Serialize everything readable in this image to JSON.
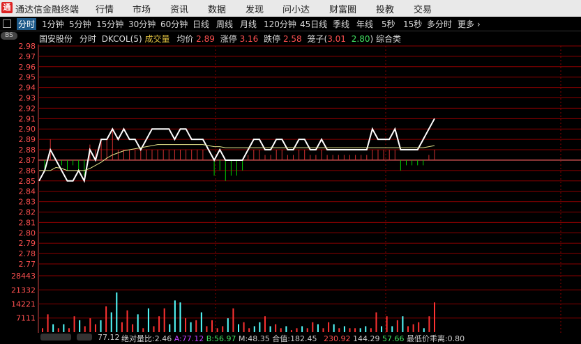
{
  "app": {
    "name": "通达信金融终端",
    "logo": "通"
  },
  "menu": [
    "行情",
    "市场",
    "资讯",
    "数据",
    "发现",
    "问小达",
    "财富圈",
    "投教",
    "交易"
  ],
  "toolbar": {
    "items": [
      "分时",
      "1分钟",
      "5分钟",
      "15分钟",
      "30分钟",
      "60分钟",
      "日线",
      "周线",
      "月线",
      "120分钟",
      "45日线",
      "季线",
      "年线",
      "5秒",
      "15秒",
      "多分时",
      "更多"
    ],
    "active": "分时",
    "more_icon": "chevron-right-icon"
  },
  "badge": "BS",
  "info": {
    "stock_name": "国安股份",
    "mode": "分时",
    "indicator": "DKCOL(5)",
    "vol_label": "成交量",
    "avg_label": "均价",
    "avg_value": "2.89",
    "limit_up_label": "涨停",
    "limit_up_value": "3.16",
    "limit_down_label": "跌停",
    "limit_down_value": "2.58",
    "cage_label": "笼子",
    "cage_open": "(",
    "cage_v1": "3.01",
    "cage_v2": "2.80",
    "cage_close": ")",
    "category": "综合类"
  },
  "chart_data": [
    {
      "type": "line",
      "ylim": [
        2.77,
        2.98
      ],
      "y_ticks": [
        "2.98",
        "2.97",
        "2.96",
        "2.95",
        "2.94",
        "2.93",
        "2.92",
        "2.91",
        "2.90",
        "2.89",
        "2.88",
        "2.87",
        "2.86",
        "2.85",
        "2.84",
        "2.83",
        "2.82",
        "2.81",
        "2.80",
        "2.79",
        "2.78",
        "2.77"
      ],
      "reference_price": 2.87,
      "series": [
        {
          "name": "price",
          "color": "#ffffff",
          "values": [
            2.85,
            2.86,
            2.88,
            2.87,
            2.86,
            2.85,
            2.85,
            2.86,
            2.85,
            2.88,
            2.87,
            2.89,
            2.89,
            2.9,
            2.89,
            2.9,
            2.89,
            2.89,
            2.88,
            2.89,
            2.9,
            2.9,
            2.9,
            2.9,
            2.89,
            2.9,
            2.9,
            2.89,
            2.89,
            2.89,
            2.88,
            2.87,
            2.88,
            2.87,
            2.87,
            2.87,
            2.87,
            2.88,
            2.89,
            2.89,
            2.88,
            2.88,
            2.89,
            2.89,
            2.88,
            2.88,
            2.89,
            2.89,
            2.88,
            2.88,
            2.89,
            2.88,
            2.88,
            2.88,
            2.88,
            2.88,
            2.88,
            2.88,
            2.88,
            2.9,
            2.89,
            2.89,
            2.89,
            2.9,
            2.88,
            2.88,
            2.88,
            2.88,
            2.89,
            2.9,
            2.91
          ]
        },
        {
          "name": "avg",
          "color": "#e6e68c",
          "values": [
            2.86,
            2.86,
            2.86,
            2.863,
            2.862,
            2.86,
            2.86,
            2.86,
            2.86,
            2.862,
            2.865,
            2.868,
            2.872,
            2.875,
            2.877,
            2.879,
            2.88,
            2.881,
            2.882,
            2.883,
            2.884,
            2.885,
            2.885,
            2.885,
            2.885,
            2.885,
            2.885,
            2.885,
            2.885,
            2.885,
            2.884,
            2.883,
            2.883,
            2.882,
            2.882,
            2.882,
            2.882,
            2.882,
            2.882,
            2.882,
            2.882,
            2.882,
            2.882,
            2.882,
            2.882,
            2.882,
            2.882,
            2.882,
            2.882,
            2.882,
            2.882,
            2.882,
            2.882,
            2.882,
            2.882,
            2.882,
            2.882,
            2.882,
            2.882,
            2.882,
            2.882,
            2.882,
            2.882,
            2.882,
            2.882,
            2.882,
            2.882,
            2.882,
            2.882,
            2.883,
            2.884
          ]
        }
      ],
      "dkcol_bars": [
        0,
        -0.01,
        0.02,
        0,
        -0.005,
        -0.01,
        -0.005,
        -0.01,
        -0.015,
        0.015,
        0.01,
        0.02,
        0.02,
        0.03,
        0.01,
        0.01,
        0.01,
        0.01,
        0.01,
        0.01,
        0.01,
        0.01,
        0.01,
        0.01,
        0.01,
        0.01,
        0.01,
        0.01,
        0.01,
        0.01,
        0,
        -0.015,
        -0.01,
        -0.02,
        -0.015,
        -0.015,
        -0.01,
        0.005,
        0.01,
        0.01,
        0.005,
        0.005,
        0.01,
        0.01,
        0.005,
        0.005,
        0.01,
        0.01,
        0.005,
        0.005,
        0.01,
        0.005,
        0.005,
        0.005,
        0.005,
        0.005,
        0.005,
        0.005,
        0.005,
        0.01,
        0.01,
        0.01,
        0.01,
        0.01,
        -0.01,
        -0.005,
        -0.005,
        -0.005,
        -0.005,
        0.005,
        0.01
      ]
    },
    {
      "type": "bar",
      "ylim": [
        0,
        28443
      ],
      "y_ticks": [
        "28443",
        "21332",
        "14221",
        "7111"
      ],
      "values": [
        2000,
        9000,
        4000,
        2000,
        4000,
        2000,
        8000,
        6000,
        3000,
        7000,
        4000,
        6000,
        13000,
        10000,
        20000,
        5000,
        11000,
        4000,
        9000,
        2000,
        12000,
        3000,
        8000,
        12000,
        4000,
        16000,
        15000,
        7000,
        5000,
        6000,
        10000,
        3000,
        6000,
        2000,
        3000,
        7000,
        12000,
        4000,
        5000,
        2000,
        3000,
        5000,
        8000,
        3000,
        4000,
        2000,
        3000,
        1000,
        2000,
        3000,
        2000,
        5000,
        4000,
        2000,
        5000,
        4000,
        2000,
        3000,
        2000,
        2000,
        2000,
        3000,
        2000,
        10000,
        3000,
        8000,
        3000,
        6000,
        8000,
        3000,
        4000,
        5000,
        2000,
        8000,
        15000
      ],
      "colors": [
        "up",
        "up",
        "down",
        "up",
        "down",
        "up",
        "up",
        "down",
        "up",
        "up",
        "up",
        "down",
        "up",
        "down",
        "down",
        "up",
        "up",
        "up",
        "down",
        "up",
        "down",
        "up",
        "up",
        "up",
        "down",
        "down",
        "down",
        "up",
        "down",
        "up",
        "down",
        "up",
        "up",
        "up",
        "up",
        "down",
        "up",
        "down",
        "up",
        "up",
        "down",
        "down",
        "up",
        "down",
        "up",
        "up",
        "down",
        "up",
        "up",
        "down",
        "up",
        "up",
        "down",
        "up",
        "up",
        "down",
        "up",
        "down",
        "up",
        "up",
        "down",
        "down",
        "up",
        "up",
        "down",
        "up",
        "down",
        "up",
        "down",
        "up",
        "up",
        "up",
        "down",
        "up",
        "up"
      ]
    }
  ],
  "status": {
    "btn1": "",
    "btn2": "",
    "v1": "77.12",
    "v2_label": "绝对量比:",
    "v2_value": "2.46",
    "a_label": "A:",
    "a_value": "77.12",
    "b_label": "B:",
    "b_value": "56.97",
    "m_label": "M:",
    "m_value": "48.35",
    "hz_label": "合值:",
    "hz_value": "182.45",
    "v3": "230.92",
    "v4": "144.29",
    "v5": "57.66",
    "last_label": "最低价乖离:",
    "last_value": "0.80"
  },
  "colors": {
    "up": "#ff3232",
    "down": "#54ffff",
    "green": "#00d000",
    "grid": "#8b0000",
    "axis": "#c84646"
  }
}
